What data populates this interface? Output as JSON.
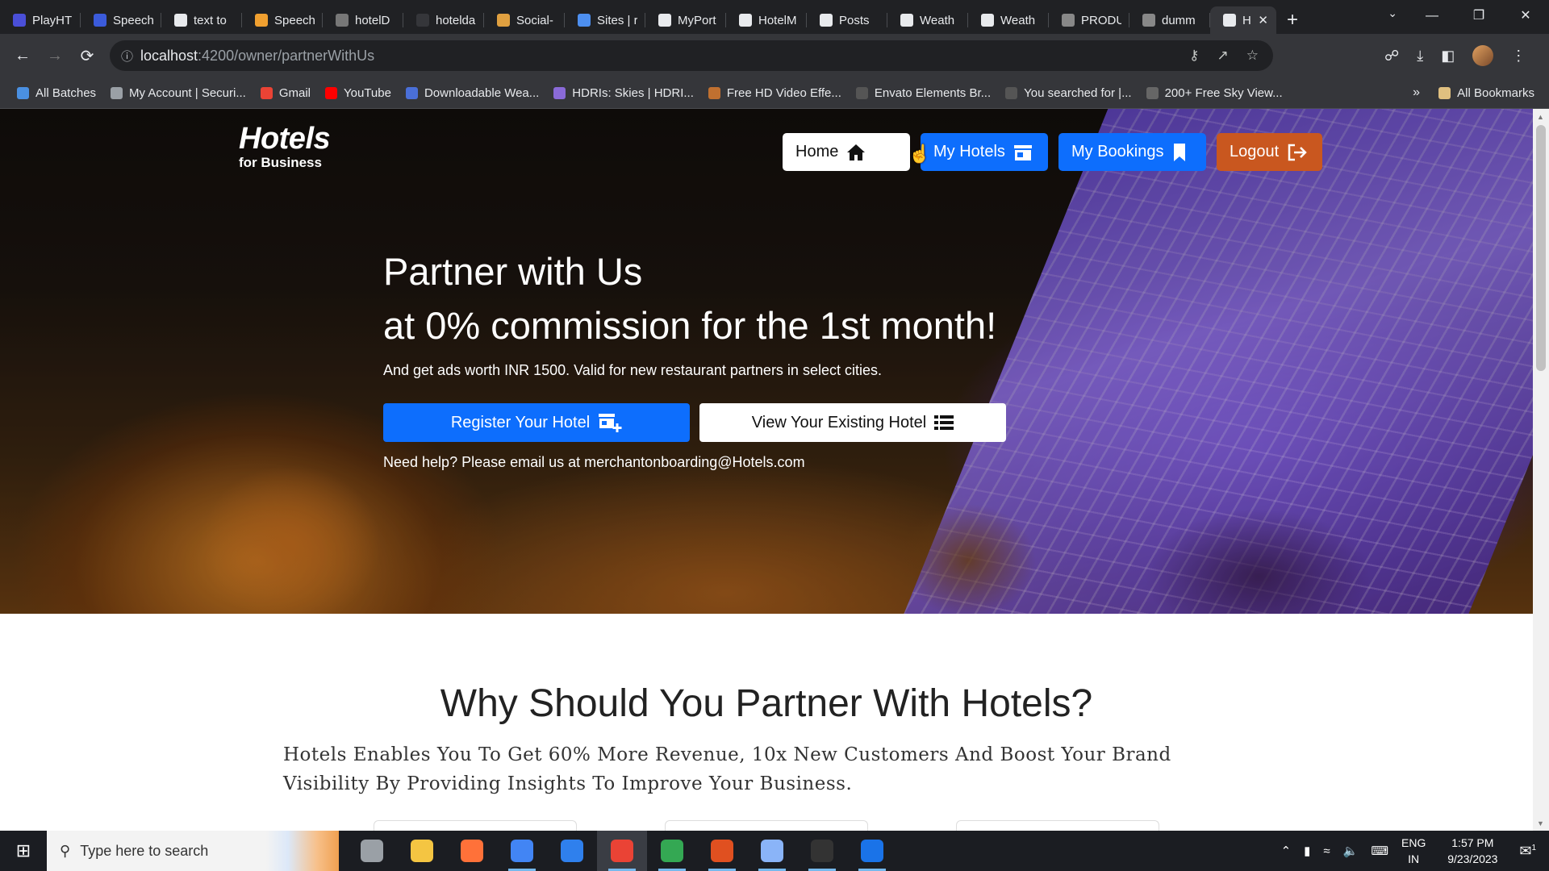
{
  "browser": {
    "tabs": [
      {
        "label": "PlayHT",
        "color": "#4a4fd8"
      },
      {
        "label": "Speech",
        "color": "#3b5bdb"
      },
      {
        "label": "text to",
        "color": "#e8eaed"
      },
      {
        "label": "Speech",
        "color": "#f0a030"
      },
      {
        "label": "hotelD",
        "color": "#777777"
      },
      {
        "label": "hotelda",
        "color": "#35363a"
      },
      {
        "label": "Social-",
        "color": "#e0a040"
      },
      {
        "label": "Sites | r",
        "color": "#4d8ff0"
      },
      {
        "label": "MyPort",
        "color": "#e8eaed"
      },
      {
        "label": "HotelM",
        "color": "#e8eaed"
      },
      {
        "label": "Posts",
        "color": "#e8eaed"
      },
      {
        "label": "Weath",
        "color": "#e8eaed"
      },
      {
        "label": "Weath",
        "color": "#e8eaed"
      },
      {
        "label": "PRODU",
        "color": "#888888"
      },
      {
        "label": "dumm",
        "color": "#888888"
      },
      {
        "label": "Hot",
        "color": "#e8eaed"
      }
    ],
    "url_host": "localhost",
    "url_path": ":4200/owner/partnerWithUs",
    "bookmarks": [
      {
        "label": "All Batches",
        "color": "#4a90e2"
      },
      {
        "label": "My Account | Securi...",
        "color": "#9aa0a6"
      },
      {
        "label": "Gmail",
        "color": "#ea4335"
      },
      {
        "label": "YouTube",
        "color": "#ff0000"
      },
      {
        "label": "Downloadable Wea...",
        "color": "#4a6fd8"
      },
      {
        "label": "HDRIs: Skies | HDRI...",
        "color": "#8a6ad8"
      },
      {
        "label": "Free HD Video Effe...",
        "color": "#c07030"
      },
      {
        "label": "Envato Elements Br...",
        "color": "#555555"
      },
      {
        "label": "You searched for |...",
        "color": "#555555"
      },
      {
        "label": "200+ Free Sky View...",
        "color": "#666666"
      }
    ],
    "all_bookmarks": "All Bookmarks"
  },
  "site": {
    "brand_title": "Hotels",
    "brand_sub": "for Business",
    "nav": {
      "home": "Home",
      "hotels": "My Hotels",
      "bookings": "My Bookings",
      "logout": "Logout"
    },
    "hero": {
      "headline_1": "Partner with Us",
      "headline_2": "at 0% commission for the 1st month!",
      "subtext": "And get ads worth INR 1500. Valid for new restaurant partners in select cities.",
      "register_btn": "Register Your Hotel",
      "view_btn": "View Your Existing Hotel",
      "help": "Need help? Please email us at merchantonboarding@Hotels.com"
    },
    "why": {
      "title": "Why Should You Partner With Hotels?",
      "text": "Hotels Enables You To Get 60% More Revenue, 10x New Customers And Boost Your Brand Visibility By Providing Insights To Improve Your Business."
    }
  },
  "taskbar": {
    "search_placeholder": "Type here to search",
    "apps": [
      {
        "name": "settings-app",
        "color": "#9aa0a6"
      },
      {
        "name": "file-explorer-app",
        "color": "#f4c542"
      },
      {
        "name": "firefox-app",
        "color": "#ff7139"
      },
      {
        "name": "chrome-app-1",
        "color": "#4285f4"
      },
      {
        "name": "vscode-app",
        "color": "#2f80ed"
      },
      {
        "name": "chrome-app-2",
        "color": "#ea4335"
      },
      {
        "name": "chrome-app-3",
        "color": "#34a853"
      },
      {
        "name": "obs-app",
        "color": "#e05020"
      },
      {
        "name": "notes-app",
        "color": "#8ab4f8"
      },
      {
        "name": "terminal-app",
        "color": "#333333"
      },
      {
        "name": "media-app",
        "color": "#1a73e8"
      }
    ],
    "lang_1": "ENG",
    "lang_2": "IN",
    "time": "1:57 PM",
    "date": "9/23/2023",
    "notifications": "1"
  }
}
